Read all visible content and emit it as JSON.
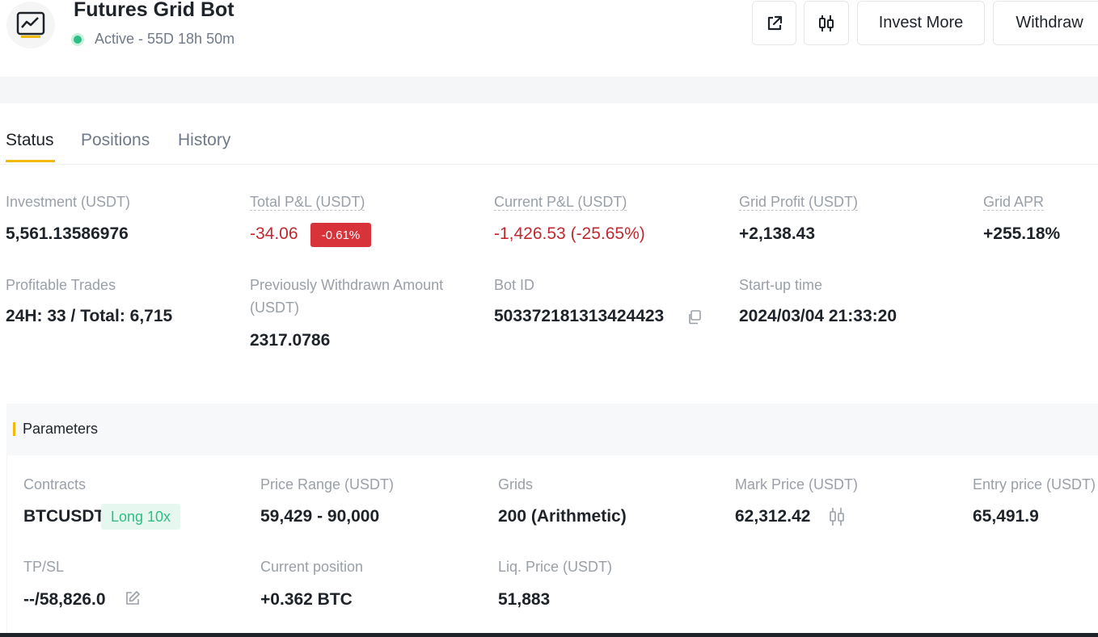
{
  "header": {
    "title": "Futures Grid Bot",
    "status": "Active - 55D 18h 50m",
    "invest_more_label": "Invest More",
    "withdraw_label": "Withdraw",
    "icons": [
      "chart-line-icon",
      "share-external-icon",
      "candlestick-icon"
    ]
  },
  "tabs": [
    {
      "label": "Status",
      "active": true
    },
    {
      "label": "Positions",
      "active": false
    },
    {
      "label": "History",
      "active": false
    }
  ],
  "stats": {
    "investment": {
      "label": "Investment (USDT)",
      "value": "5,561.13586976"
    },
    "total_pnl": {
      "label": "Total P&L (USDT)",
      "value": "-34.06",
      "badge": "-0.61%"
    },
    "current_pnl": {
      "label": "Current P&L (USDT)",
      "value": "-1,426.53 (-25.65%)"
    },
    "grid_profit": {
      "label": "Grid Profit (USDT)",
      "value": "+2,138.43"
    },
    "grid_apr": {
      "label": "Grid APR",
      "value": "+255.18%"
    },
    "profitable_trades": {
      "label": "Profitable Trades",
      "value": "24H: 33 / Total: 6,715"
    },
    "withdrawn": {
      "label_line1": "Previously Withdrawn Amount",
      "label_line2": "(USDT)",
      "value": "2317.0786"
    },
    "bot_id": {
      "label": "Bot ID",
      "value": "503372181313424423"
    },
    "startup": {
      "label": "Start-up time",
      "value": "2024/03/04 21:33:20"
    }
  },
  "parameters": {
    "title": "Parameters",
    "contracts": {
      "label": "Contracts",
      "value": "BTCUSDT",
      "badge": "Long 10x"
    },
    "price_range": {
      "label": "Price Range (USDT)",
      "value": "59,429 - 90,000"
    },
    "grids": {
      "label": "Grids",
      "value": "200 (Arithmetic)"
    },
    "mark_price": {
      "label": "Mark Price (USDT)",
      "value": "62,312.42"
    },
    "entry_price": {
      "label": "Entry price (USDT)",
      "value": "65,491.9"
    },
    "tpsl": {
      "label": "TP/SL",
      "value": "--/58,826.0"
    },
    "current_position": {
      "label": "Current position",
      "value": "+0.362 BTC"
    },
    "liq_price": {
      "label": "Liq. Price (USDT)",
      "value": "51,883"
    }
  },
  "colors": {
    "accent": "#f0b90b",
    "negative": "#c0292f",
    "positive_badge": "#2ebd85",
    "active_dot": "#2ebd85"
  }
}
